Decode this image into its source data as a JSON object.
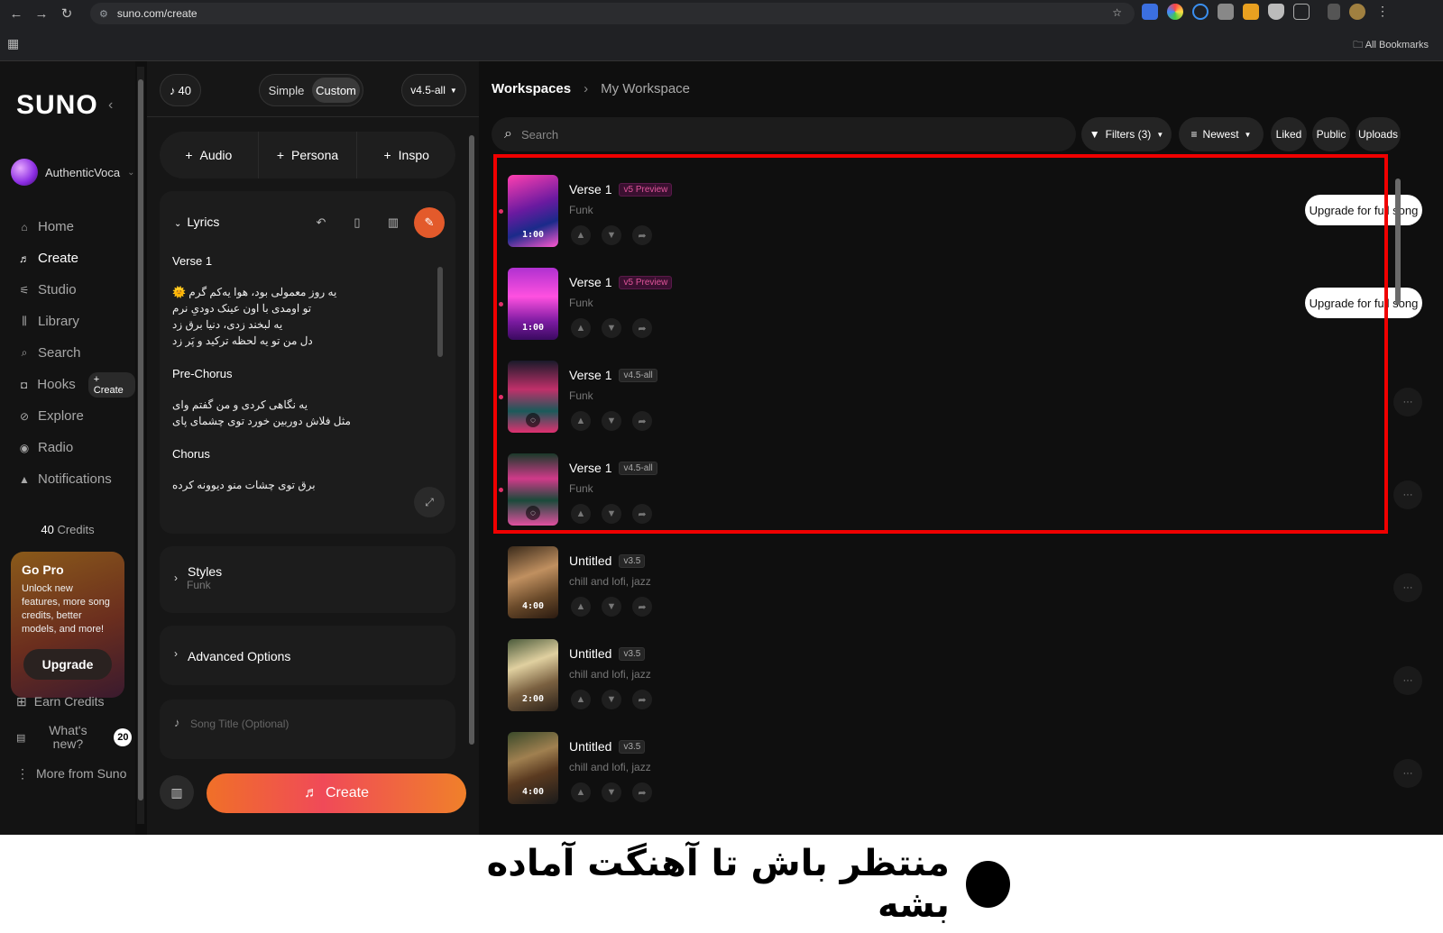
{
  "browser": {
    "url": "suno.com/create",
    "all_bookmarks": "All Bookmarks"
  },
  "sidebar": {
    "logo": "SUNO",
    "username": "AuthenticVoca",
    "nav": [
      {
        "label": "Home",
        "icon": "home-icon"
      },
      {
        "label": "Create",
        "icon": "create-icon"
      },
      {
        "label": "Studio",
        "icon": "studio-icon"
      },
      {
        "label": "Library",
        "icon": "library-icon"
      },
      {
        "label": "Search",
        "icon": "search-icon"
      },
      {
        "label": "Hooks",
        "icon": "hooks-icon"
      },
      {
        "label": "Explore",
        "icon": "explore-icon"
      },
      {
        "label": "Radio",
        "icon": "radio-icon"
      },
      {
        "label": "Notifications",
        "icon": "bell-icon"
      }
    ],
    "hooks_create": "+ Create",
    "credits_num": "40",
    "credits_label": "Credits",
    "gopro_title": "Go Pro",
    "gopro_text": "Unlock new features, more song credits, better models, and more!",
    "upgrade": "Upgrade",
    "earn_credits": "Earn Credits",
    "whats_new": "What's new?",
    "whats_new_count": "20",
    "more_from_suno": "More from Suno"
  },
  "create": {
    "credits": "40",
    "mode_simple": "Simple",
    "mode_custom": "Custom",
    "model": "v4.5-all",
    "add_audio": "Audio",
    "add_persona": "Persona",
    "add_inspo": "Inspo",
    "lyrics_label": "Lyrics",
    "lyrics": [
      {
        "title": "Verse 1",
        "lines": [
          "یه روز معمولی بود، هوا یه‌کم گرم 🌞",
          "تو اومدی با اون عینک دودیِ نرم",
          "یه لبخند زدی، دنیا برق زد",
          "دل من تو یه لحظه ترکید و پَر زد"
        ]
      },
      {
        "title": "Pre-Chorus",
        "lines": [
          "یه نگاهی کردی و من گفتم وای",
          "مثل فلاش دوربین خورد توی چشمای پای"
        ]
      },
      {
        "title": "Chorus",
        "lines": [
          "برق توی چشات منو دیوونه کرده"
        ]
      }
    ],
    "styles_label": "Styles",
    "styles_value": "Funk",
    "advanced_options": "Advanced Options",
    "song_title_placeholder": "Song Title (Optional)",
    "create_button": "Create"
  },
  "workspace": {
    "crumb_root": "Workspaces",
    "crumb_current": "My Workspace",
    "search_placeholder": "Search",
    "filters": "Filters (3)",
    "sort": "Newest",
    "liked": "Liked",
    "public": "Public",
    "uploads": "Uploads",
    "upgrade_full": "Upgrade for full song",
    "songs": [
      {
        "title": "Verse 1",
        "version": "v5 Preview",
        "style": "Funk",
        "duration": "1:00",
        "state": "preview"
      },
      {
        "title": "Verse 1",
        "version": "v5 Preview",
        "style": "Funk",
        "duration": "1:00",
        "state": "preview"
      },
      {
        "title": "Verse 1",
        "version": "v4.5-all",
        "style": "Funk",
        "duration": "",
        "state": "generating"
      },
      {
        "title": "Verse 1",
        "version": "v4.5-all",
        "style": "Funk",
        "duration": "",
        "state": "generating"
      },
      {
        "title": "Untitled",
        "version": "v3.5",
        "style": "chill and lofi, jazz",
        "duration": "4:00",
        "state": "done"
      },
      {
        "title": "Untitled",
        "version": "v3.5",
        "style": "chill and lofi, jazz",
        "duration": "2:00",
        "state": "done"
      },
      {
        "title": "Untitled",
        "version": "v3.5",
        "style": "chill and lofi, jazz",
        "duration": "4:00",
        "state": "done"
      }
    ]
  },
  "caption": "منتظر باش تا آهنگت آماده بشه",
  "colors": {
    "highlight": "#f00000",
    "accent": "#e35a2b",
    "preview_tag": "#e0559a"
  }
}
